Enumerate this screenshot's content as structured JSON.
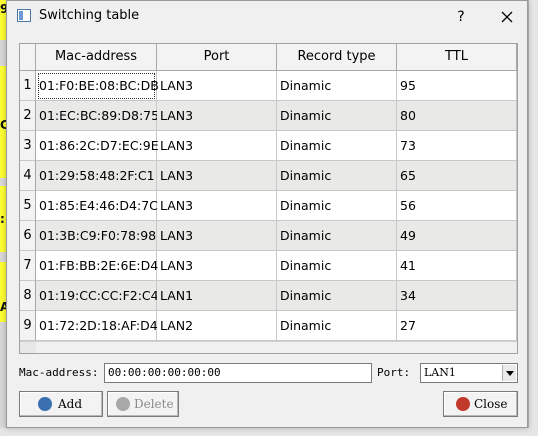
{
  "background": {
    "glyphs": [
      "9",
      "Ch",
      ":",
      "AS"
    ]
  },
  "dialog": {
    "title": "Switching table",
    "help_label": "?"
  },
  "table": {
    "columns": [
      "Mac-address",
      "Port",
      "Record type",
      "TTL"
    ],
    "rows": [
      {
        "num": "1",
        "mac": "01:F0:BE:08:BC:DB",
        "port": "LAN3",
        "type": "Dinamic",
        "ttl": "95"
      },
      {
        "num": "2",
        "mac": "01:EC:BC:89:D8:75",
        "port": "LAN3",
        "type": "Dinamic",
        "ttl": "80"
      },
      {
        "num": "3",
        "mac": "01:86:2C:D7:EC:9E",
        "port": "LAN3",
        "type": "Dinamic",
        "ttl": "73"
      },
      {
        "num": "4",
        "mac": "01:29:58:48:2F:C1",
        "port": "LAN3",
        "type": "Dinamic",
        "ttl": "65"
      },
      {
        "num": "5",
        "mac": "01:85:E4:46:D4:7C",
        "port": "LAN3",
        "type": "Dinamic",
        "ttl": "56"
      },
      {
        "num": "6",
        "mac": "01:3B:C9:F0:78:98",
        "port": "LAN3",
        "type": "Dinamic",
        "ttl": "49"
      },
      {
        "num": "7",
        "mac": "01:FB:BB:2E:6E:D4",
        "port": "LAN3",
        "type": "Dinamic",
        "ttl": "41"
      },
      {
        "num": "8",
        "mac": "01:19:CC:CC:F2:C4",
        "port": "LAN1",
        "type": "Dinamic",
        "ttl": "34"
      },
      {
        "num": "9",
        "mac": "01:72:2D:18:AF:D4",
        "port": "LAN2",
        "type": "Dinamic",
        "ttl": "27"
      }
    ]
  },
  "form": {
    "mac_label": "Mac-address:",
    "mac_value": "00:00:00:00:00:00",
    "port_label": "Port:",
    "port_value": "LAN1"
  },
  "buttons": {
    "add": "Add",
    "delete": "Delete",
    "close": "Close"
  },
  "colors": {
    "add_icon": "#3a6fb0",
    "delete_icon": "#a8a8a8",
    "close_icon": "#c0392b"
  }
}
